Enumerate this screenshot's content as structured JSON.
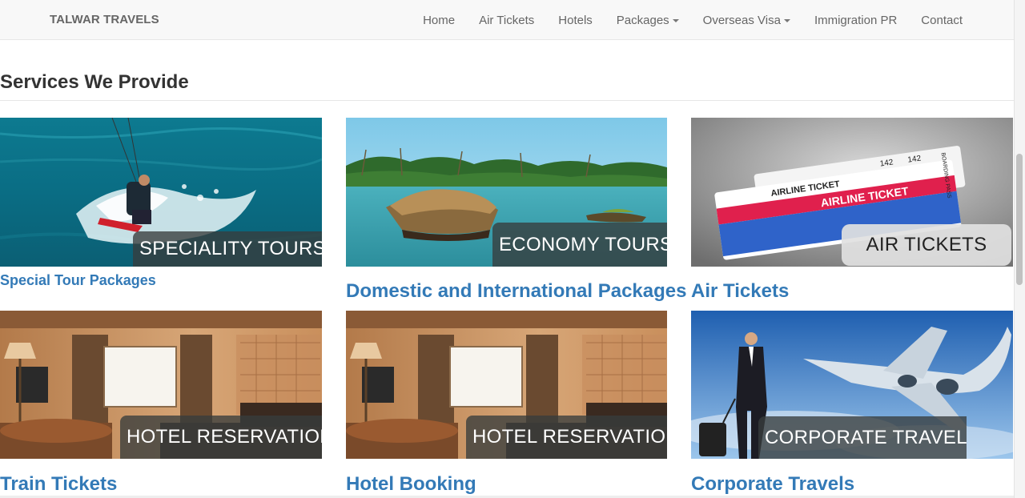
{
  "navbar": {
    "brand": "TALWAR TRAVELS",
    "items": [
      {
        "label": "Home",
        "dropdown": false
      },
      {
        "label": "Air Tickets",
        "dropdown": false
      },
      {
        "label": "Hotels",
        "dropdown": false
      },
      {
        "label": "Packages",
        "dropdown": true
      },
      {
        "label": "Overseas Visa",
        "dropdown": true
      },
      {
        "label": "Immigration PR",
        "dropdown": false
      },
      {
        "label": "Contact",
        "dropdown": false
      }
    ]
  },
  "main": {
    "section_title": "Services We Provide",
    "cards": [
      {
        "overlay": "SPECIALITY TOURS",
        "title": "Special Tour Packages"
      },
      {
        "overlay": "ECONOMY TOURS",
        "title": "Domestic and International Packages"
      },
      {
        "overlay": "AIR TICKETS",
        "title": "Air Tickets",
        "ticket": {
          "header": "AIRLINE TICKET",
          "title": "AIRLINE TICKET",
          "num1": "142",
          "num2": "142",
          "side": "BOARDING PASS"
        }
      },
      {
        "overlay": "HOTEL RESERVATION",
        "title": "Train Tickets"
      },
      {
        "overlay": "HOTEL RESERVATION",
        "title": "Hotel Booking"
      },
      {
        "overlay": "CORPORATE TRAVEL",
        "title": "Corporate Travels"
      }
    ]
  },
  "colors": {
    "link": "#337ab7",
    "nav_text": "#666666",
    "navbar_bg": "#f8f8f8",
    "heading": "#333333"
  }
}
